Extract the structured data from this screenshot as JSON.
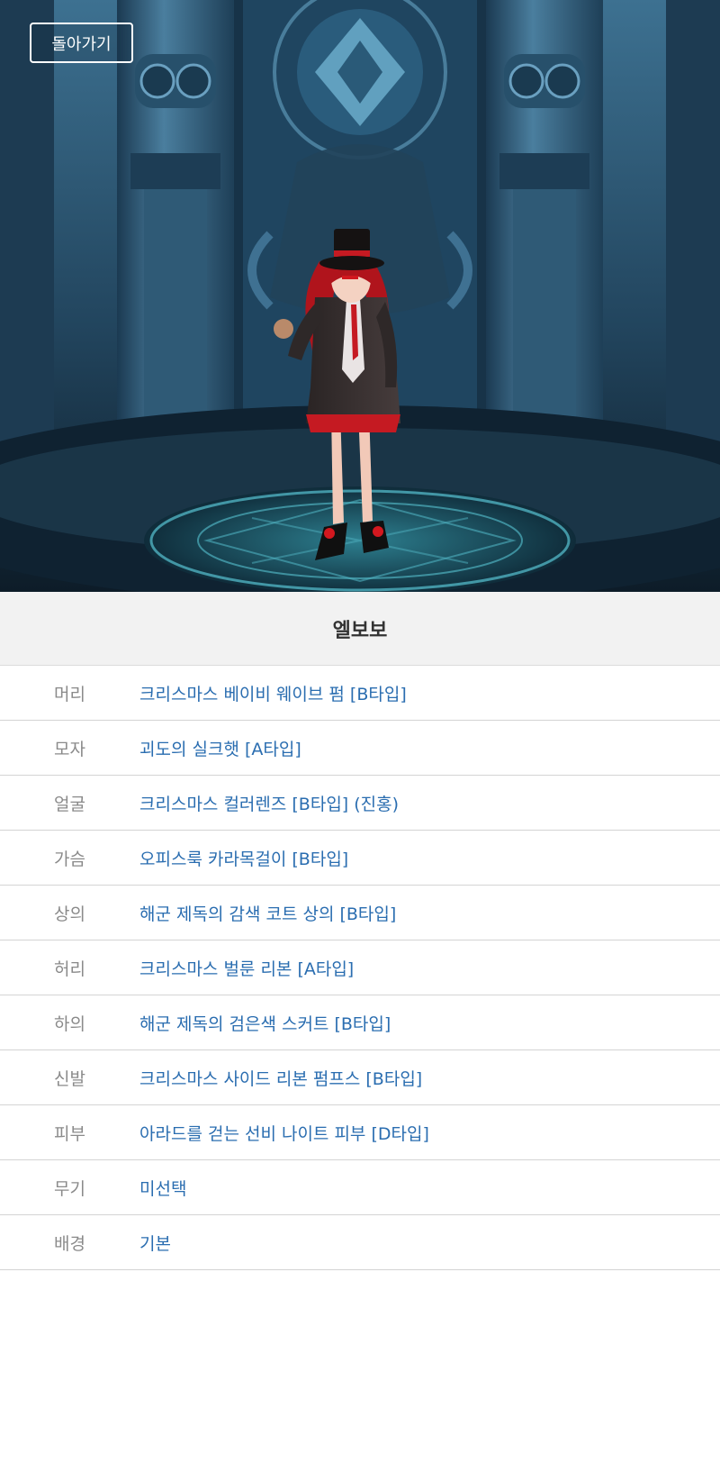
{
  "header": {
    "back_label": "돌아가기"
  },
  "character": {
    "name": "엘보보"
  },
  "equipment": [
    {
      "slot": "머리",
      "item": "크리스마스 베이비 웨이브 펌 [B타입]"
    },
    {
      "slot": "모자",
      "item": "괴도의 실크햇 [A타입]"
    },
    {
      "slot": "얼굴",
      "item": "크리스마스 컬러렌즈 [B타입]  (진홍)"
    },
    {
      "slot": "가슴",
      "item": "오피스룩 카라목걸이 [B타입]"
    },
    {
      "slot": "상의",
      "item": "해군 제독의 감색 코트 상의 [B타입]"
    },
    {
      "slot": "허리",
      "item": "크리스마스 벌룬 리본 [A타입]"
    },
    {
      "slot": "하의",
      "item": "해군 제독의 검은색 스커트 [B타입]"
    },
    {
      "slot": "신발",
      "item": "크리스마스 사이드 리본 펌프스 [B타입]"
    },
    {
      "slot": "피부",
      "item": "아라드를 걷는 선비 나이트 피부 [D타입]"
    },
    {
      "slot": "무기",
      "item": "미선택"
    },
    {
      "slot": "배경",
      "item": "기본"
    }
  ],
  "colors": {
    "item_link": "#2a6db0",
    "slot_label": "#8a8a8a",
    "title_bar_bg": "#f2f2f2"
  },
  "icons": {
    "background": "temple-background-illustration",
    "character": "character-sprite"
  }
}
